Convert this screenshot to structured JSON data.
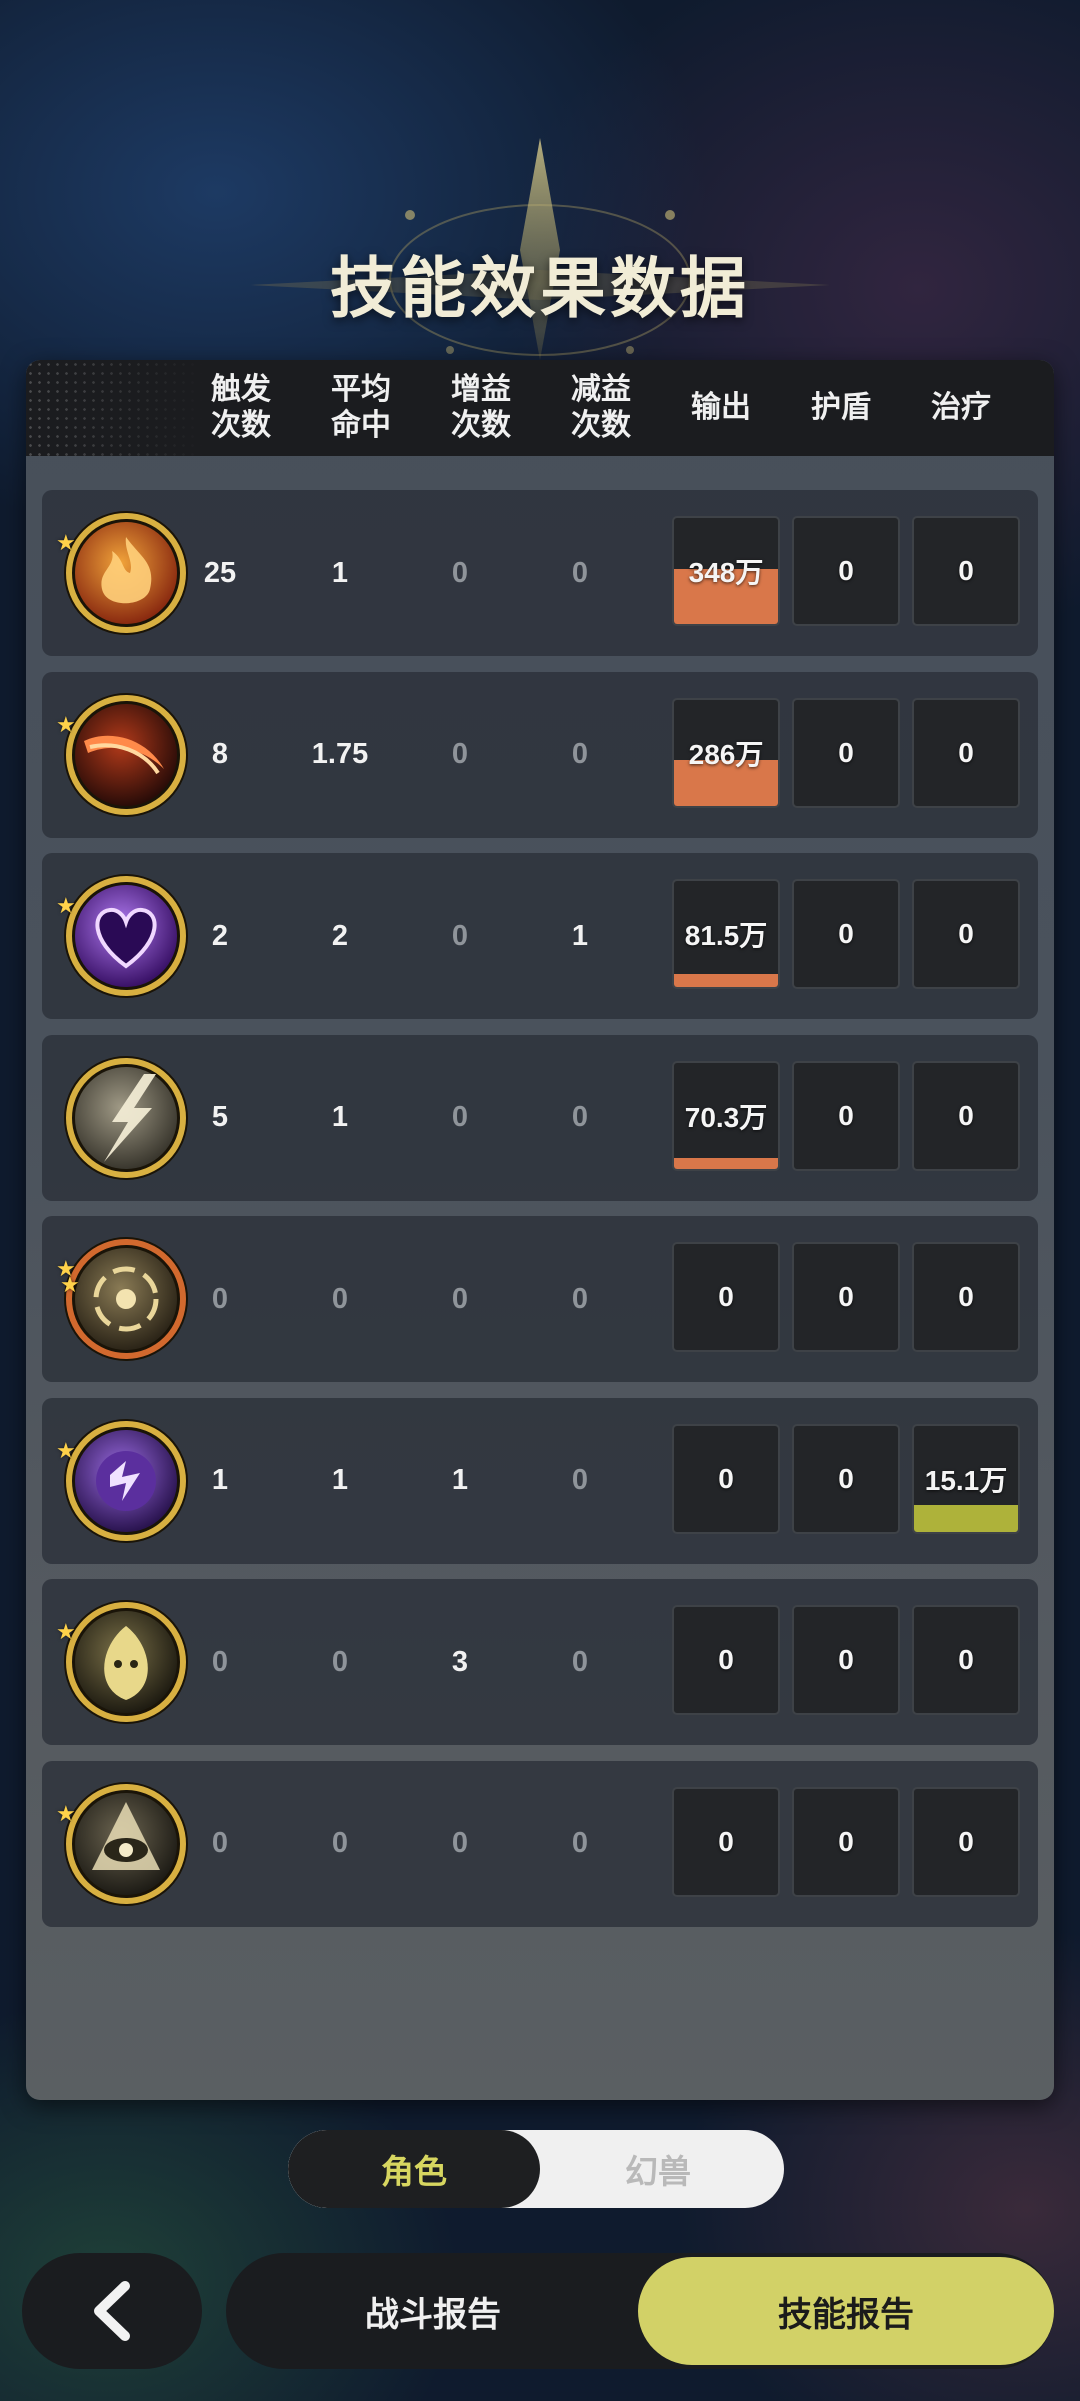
{
  "title": "技能效果数据",
  "header": {
    "columns": [
      {
        "line1": "触发",
        "line2": "次数"
      },
      {
        "line1": "平均",
        "line2": "命中"
      },
      {
        "line1": "增益",
        "line2": "次数"
      },
      {
        "line1": "减益",
        "line2": "次数"
      },
      {
        "line1": "输出",
        "line2": ""
      },
      {
        "line1": "护盾",
        "line2": ""
      },
      {
        "line1": "治疗",
        "line2": ""
      }
    ]
  },
  "colors": {
    "output_bar": "#d9774a",
    "heal_bar": "#aeb23a",
    "accent": "#d2d167"
  },
  "rows": [
    {
      "icon": "fire-skill-icon",
      "stars": 1,
      "trigger": "25",
      "avg_hit": "1",
      "buff": "0",
      "debuff": "0",
      "output": "348万",
      "output_fill": 0.52,
      "shield": "0",
      "heal": "0",
      "heal_fill": 0
    },
    {
      "icon": "slash-skill-icon",
      "stars": 1,
      "trigger": "8",
      "avg_hit": "1.75",
      "buff": "0",
      "debuff": "0",
      "output": "286万",
      "output_fill": 0.43,
      "shield": "0",
      "heal": "0",
      "heal_fill": 0
    },
    {
      "icon": "void-heart-skill-icon",
      "stars": 1,
      "trigger": "2",
      "avg_hit": "2",
      "buff": "0",
      "debuff": "1",
      "output": "81.5万",
      "output_fill": 0.12,
      "shield": "0",
      "heal": "0",
      "heal_fill": 0
    },
    {
      "icon": "lightning-strike-skill-icon",
      "stars": 0,
      "trigger": "5",
      "avg_hit": "1",
      "buff": "0",
      "debuff": "0",
      "output": "70.3万",
      "output_fill": 0.1,
      "shield": "0",
      "heal": "0",
      "heal_fill": 0
    },
    {
      "icon": "vortex-skill-icon",
      "stars": 2,
      "trigger": "0",
      "avg_hit": "0",
      "buff": "0",
      "debuff": "0",
      "output": "0",
      "output_fill": 0,
      "shield": "0",
      "heal": "0",
      "heal_fill": 0
    },
    {
      "icon": "purple-storm-skill-icon",
      "stars": 1,
      "trigger": "1",
      "avg_hit": "1",
      "buff": "1",
      "debuff": "0",
      "output": "0",
      "output_fill": 0,
      "shield": "0",
      "heal": "15.1万",
      "heal_fill": 0.25
    },
    {
      "icon": "golden-spirit-skill-icon",
      "stars": 1,
      "trigger": "0",
      "avg_hit": "0",
      "buff": "3",
      "debuff": "0",
      "output": "0",
      "output_fill": 0,
      "shield": "0",
      "heal": "0",
      "heal_fill": 0
    },
    {
      "icon": "eye-skill-icon",
      "stars": 1,
      "trigger": "0",
      "avg_hit": "0",
      "buff": "0",
      "debuff": "0",
      "output": "0",
      "output_fill": 0,
      "shield": "0",
      "heal": "0",
      "heal_fill": 0
    }
  ],
  "toggle": {
    "active": "角色",
    "inactive": "幻兽"
  },
  "bottom": {
    "back_icon": "chevron-left-icon",
    "tab_battle": "战斗报告",
    "tab_skill": "技能报告"
  }
}
